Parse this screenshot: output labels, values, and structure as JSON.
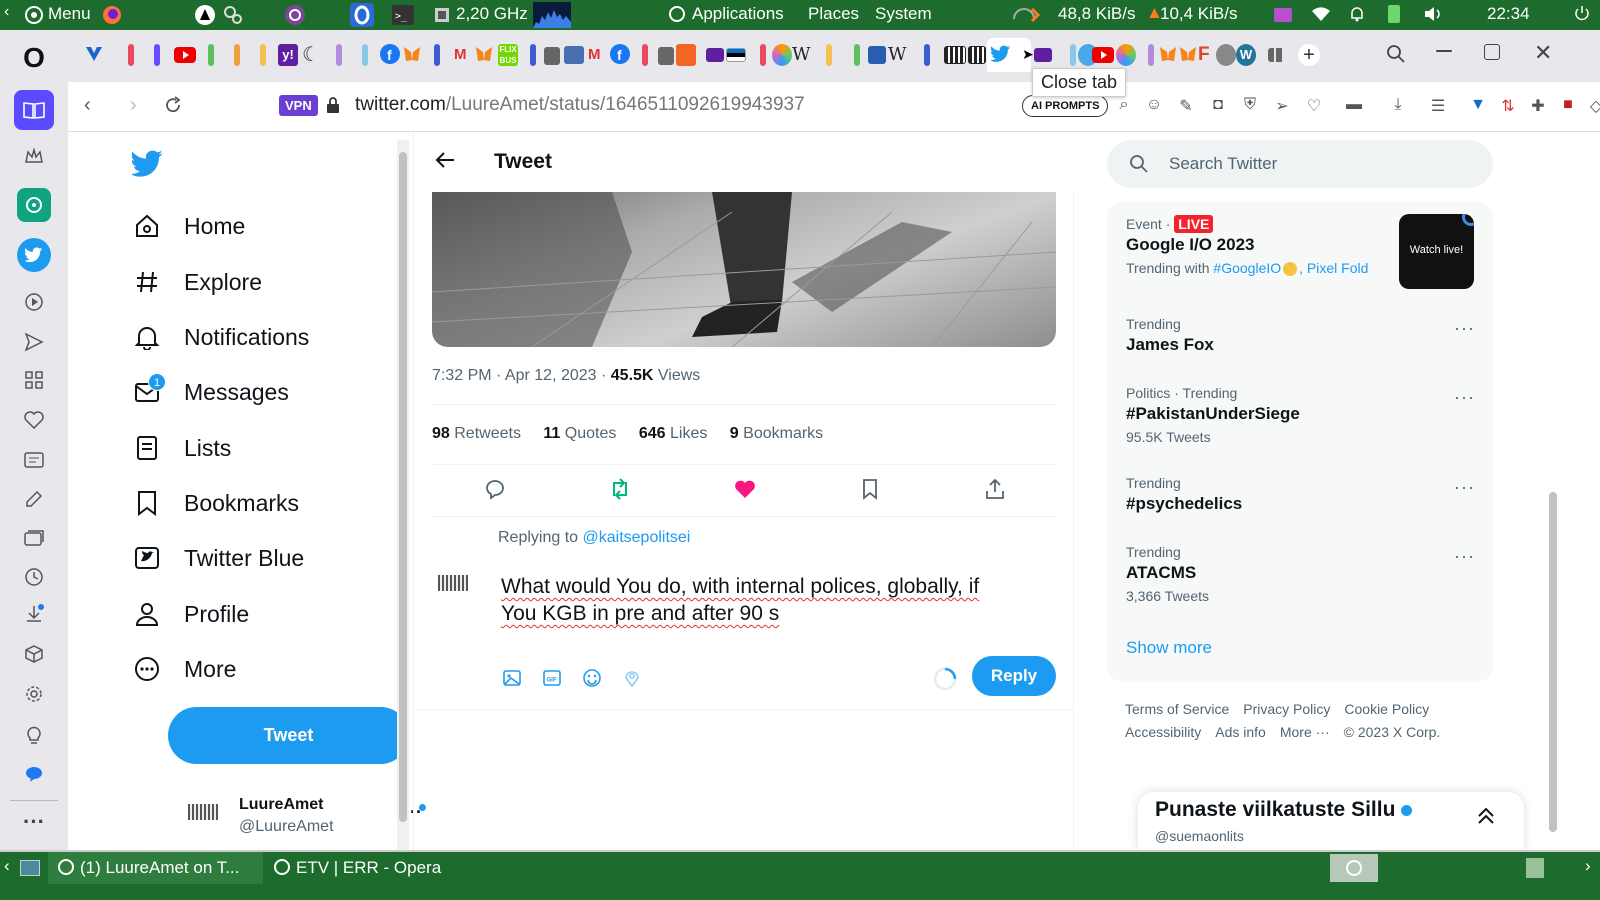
{
  "os_panel": {
    "menu_label": "Menu",
    "cpu": "2,20 GHz",
    "applications": "Applications",
    "places": "Places",
    "system": "System",
    "download_speed": "48,8 KiB/s",
    "upload_speed": "10,4 KiB/s",
    "clock": "22:34"
  },
  "browser": {
    "tooltip": "Close tab",
    "vpn_label": "VPN",
    "url_host": "twitter.com",
    "url_path": "/LuureAmet/status/1646511092619943937",
    "ai_prompts": "AI PROMPTS"
  },
  "twitter_nav": {
    "items": [
      {
        "label": "Home",
        "icon": "home-icon"
      },
      {
        "label": "Explore",
        "icon": "hashtag-icon"
      },
      {
        "label": "Notifications",
        "icon": "bell-icon"
      },
      {
        "label": "Messages",
        "icon": "envelope-icon",
        "badge": "1"
      },
      {
        "label": "Lists",
        "icon": "list-icon"
      },
      {
        "label": "Bookmarks",
        "icon": "bookmark-icon"
      },
      {
        "label": "Twitter Blue",
        "icon": "twitter-blue-icon"
      },
      {
        "label": "Profile",
        "icon": "person-icon"
      },
      {
        "label": "More",
        "icon": "more-circle-icon"
      }
    ],
    "tweet_button": "Tweet",
    "account_name": "LuureAmet",
    "account_handle": "@LuureAmet"
  },
  "tweet_page": {
    "header_title": "Tweet",
    "timestamp": "7:32 PM · Apr 12, 2023 · ",
    "views_count": "45.5K",
    "views_label": " Views",
    "stats": [
      {
        "count": "98",
        "label": "Retweets"
      },
      {
        "count": "11",
        "label": "Quotes"
      },
      {
        "count": "646",
        "label": "Likes"
      },
      {
        "count": "9",
        "label": "Bookmarks"
      }
    ],
    "replying_to_prefix": "Replying to ",
    "replying_to_handle": "@kaitsepolitsei",
    "reply_text_line1": "What would You do, with internal polices, globally, if",
    "reply_text_line2": "You KGB in pre and after 90 s",
    "reply_button": "Reply"
  },
  "sidebar_right": {
    "search_placeholder": "Search Twitter",
    "event_meta": "Event · ",
    "event_live": "LIVE",
    "event_name": "Google I/O 2023",
    "event_trending_with": "Trending with ",
    "event_tag1": "#GoogleIO",
    "event_tag2": ", Pixel Fold",
    "event_thumb_text": "Watch live!",
    "trends": [
      {
        "meta": "Trending",
        "name": "James Fox",
        "count": ""
      },
      {
        "meta": "Politics · Trending",
        "name": "#PakistanUnderSiege",
        "count": "95.5K Tweets"
      },
      {
        "meta": "Trending",
        "name": "#psychedelics",
        "count": ""
      },
      {
        "meta": "Trending",
        "name": "ATACMS",
        "count": "3,366 Tweets"
      }
    ],
    "show_more": "Show more",
    "footer": [
      "Terms of Service",
      "Privacy Policy",
      "Cookie Policy",
      "Accessibility",
      "Ads info",
      "More ···",
      "© 2023 X Corp."
    ],
    "dm_name": "Punaste viilkatuste Sillu",
    "dm_handle": "@suemaonlits"
  },
  "taskbar": {
    "task1": "(1) LuureAmet on T...",
    "task2": "ETV | ERR - Opera"
  }
}
